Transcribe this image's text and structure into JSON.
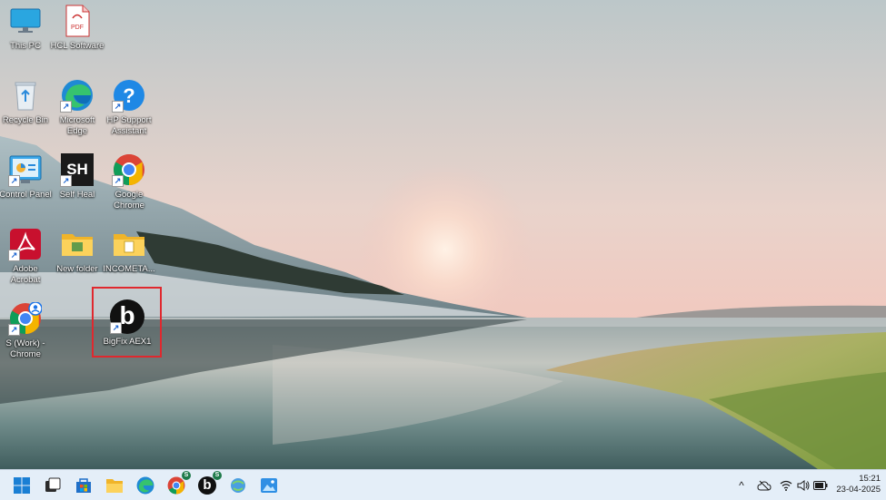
{
  "desktop": {
    "icons": [
      {
        "label": "This PC"
      },
      {
        "label": "HCL Software"
      },
      {
        "label": "Recycle Bin"
      },
      {
        "label": "Microsoft Edge"
      },
      {
        "label": "HP Support Assistant"
      },
      {
        "label": "Control Panel"
      },
      {
        "label": "Self Heal"
      },
      {
        "label": "Google Chrome"
      },
      {
        "label": "Adobe Acrobat"
      },
      {
        "label": "New folder"
      },
      {
        "label": "INCOMETA..."
      },
      {
        "label": "S (Work) - Chrome"
      },
      {
        "label": "BigFix AEX1"
      }
    ],
    "pdf_badge": "PDF",
    "self_heal_glyph": "SH",
    "bigfix_glyph": "b"
  },
  "taskbar": {
    "apps": [
      {
        "icon": "windows-start-icon"
      },
      {
        "icon": "task-view-icon"
      },
      {
        "icon": "microsoft-store-icon"
      },
      {
        "icon": "file-explorer-icon"
      },
      {
        "icon": "edge-icon"
      },
      {
        "icon": "chrome-work-icon",
        "badge": "S"
      },
      {
        "icon": "bigfix-icon",
        "badge": "S"
      },
      {
        "icon": "remote-desktop-icon"
      },
      {
        "icon": "photos-icon"
      }
    ],
    "tray": {
      "chevron": "^",
      "time": "15:21",
      "date": "23-04-2025"
    }
  },
  "colors": {
    "highlight": "#e0282e",
    "taskbar": "#e4eef8"
  }
}
